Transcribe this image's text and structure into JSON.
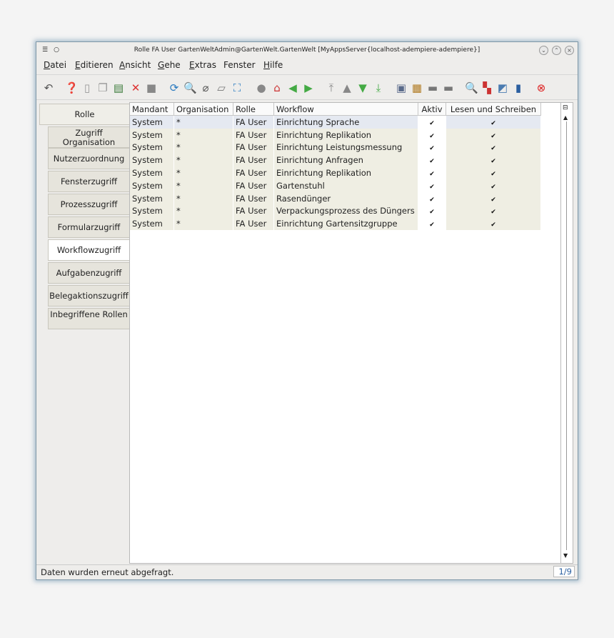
{
  "window": {
    "title": "Rolle  FA User  GartenWeltAdmin@GartenWelt.GartenWelt [MyAppsServer{localhost-adempiere-adempiere}]"
  },
  "menu": [
    {
      "label": "Datei",
      "u": "D",
      "rest": "atei"
    },
    {
      "label": "Editieren",
      "u": "E",
      "rest": "ditieren"
    },
    {
      "label": "Ansicht",
      "u": "A",
      "rest": "nsicht"
    },
    {
      "label": "Gehe",
      "u": "G",
      "rest": "ehe"
    },
    {
      "label": "Extras",
      "u": "E",
      "rest": "xtras"
    },
    {
      "label": "Fenster",
      "u": "",
      "rest": "Fenster"
    },
    {
      "label": "Hilfe",
      "u": "H",
      "rest": "ilfe"
    }
  ],
  "tabs": [
    {
      "label": "Rolle"
    },
    {
      "label": "Zugriff Organisation"
    },
    {
      "label": "Nutzerzuordnung"
    },
    {
      "label": "Fensterzugriff"
    },
    {
      "label": "Prozesszugriff"
    },
    {
      "label": "Formularzugriff"
    },
    {
      "label": "Workflowzugriff"
    },
    {
      "label": "Aufgabenzugriff"
    },
    {
      "label": "Belegaktionszugriff"
    },
    {
      "label": "Inbegriffene Rollen"
    }
  ],
  "grid": {
    "headers": [
      "Mandant",
      "Organisation",
      "Rolle",
      "Workflow",
      "Aktiv",
      "Lesen und Schreiben"
    ],
    "rows": [
      [
        "System",
        "*",
        "FA User",
        "Einrichtung Sprache"
      ],
      [
        "System",
        "*",
        "FA User",
        "Einrichtung Replikation"
      ],
      [
        "System",
        "*",
        "FA User",
        "Einrichtung Leistungsmessung"
      ],
      [
        "System",
        "*",
        "FA User",
        "Einrichtung Anfragen"
      ],
      [
        "System",
        "*",
        "FA User",
        "Einrichtung Replikation"
      ],
      [
        "System",
        "*",
        "FA User",
        "Gartenstuhl"
      ],
      [
        "System",
        "*",
        "FA User",
        "Rasendünger"
      ],
      [
        "System",
        "*",
        "FA User",
        "Verpackungsprozess des Düngers"
      ],
      [
        "System",
        "*",
        "FA User",
        "Einrichtung Gartensitzgruppe"
      ]
    ]
  },
  "status": {
    "message": "Daten wurden erneut abgefragt.",
    "count": "1/9"
  },
  "colors": {
    "accent": "#2a5fa0",
    "row_bg": "#efeee3",
    "selected_row": "#e5e9f1"
  }
}
